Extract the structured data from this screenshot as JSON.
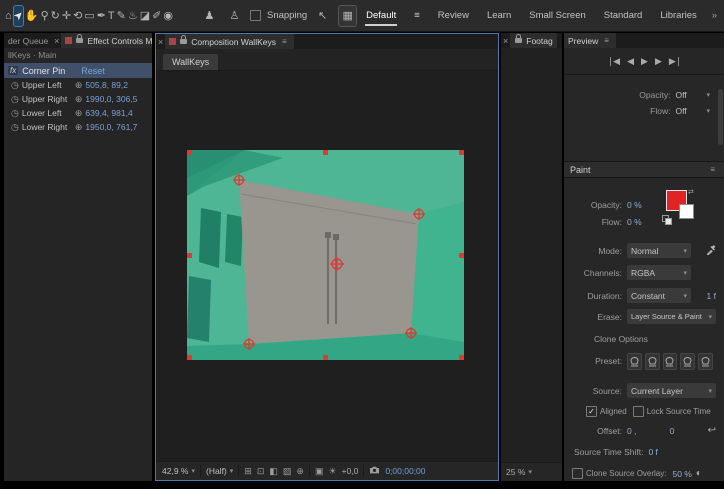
{
  "toolbar": {
    "tools": [
      {
        "name": "home",
        "glyph": "⌂"
      },
      {
        "name": "selection",
        "glyph": "➤"
      },
      {
        "name": "hand",
        "glyph": "✋"
      },
      {
        "name": "zoom",
        "glyph": "⚲"
      },
      {
        "name": "orbit",
        "glyph": "↻"
      },
      {
        "name": "pan-behind",
        "glyph": "✛"
      },
      {
        "name": "camera",
        "glyph": "⟲"
      },
      {
        "name": "mask-rect",
        "glyph": "▭"
      },
      {
        "name": "pen",
        "glyph": "✒"
      },
      {
        "name": "type",
        "glyph": "T"
      },
      {
        "name": "brush",
        "glyph": "✎"
      },
      {
        "name": "clone-stamp",
        "glyph": "♨"
      },
      {
        "name": "eraser",
        "glyph": "◪"
      },
      {
        "name": "roto-brush",
        "glyph": "✐"
      },
      {
        "name": "puppet-pin",
        "glyph": "◉"
      }
    ],
    "extra_icons": {
      "person_a": "♟",
      "person_b": "♙",
      "frame": "▦",
      "snap_after": "↖",
      "snap_grid": "▦"
    },
    "snapping_label": "Snapping",
    "workspaces": [
      "Default",
      "Review",
      "Learn",
      "Small Screen",
      "Standard",
      "Libraries"
    ],
    "overflow": "»"
  },
  "icons": {
    "menu": "≡",
    "overflow": "»",
    "close": "×",
    "chevron": "▾",
    "stopwatch": "◷",
    "crosshair": "⊕",
    "first": "❘◀",
    "prev": "◀",
    "play": "▶",
    "next": "▶",
    "last": "▶❘",
    "comp": [
      "⊞",
      "⊡",
      "◧",
      "▨",
      "⊕"
    ],
    "sun": "☀",
    "cm": "▣",
    "overlay_mode": "◐",
    "offset_reset": "↩",
    "swap": "⇄"
  },
  "effect_controls": {
    "tab_prefix": "der Queue",
    "title": "Effect Controls Main",
    "breadcrumb": "llKeys · Main",
    "effect_name": "Corner Pin",
    "fx_badge": "fx",
    "reset_label": "Reset",
    "props": [
      {
        "label": "Upper Left",
        "value": "505,8, 89,2"
      },
      {
        "label": "Upper Right",
        "value": "1990,0, 306,5"
      },
      {
        "label": "Lower Left",
        "value": "639,4, 981,4"
      },
      {
        "label": "Lower Right",
        "value": "1950,0, 761,7"
      }
    ]
  },
  "composition": {
    "title": "Composition WallKeys",
    "breadcrumb_tab": "WallKeys",
    "zoom": "42,9 %",
    "resolution": "(Half)",
    "exposure": "+0,0",
    "timecode": "0;00;00;00"
  },
  "footage": {
    "title": "Footag",
    "zoom": "25 %"
  },
  "preview": {
    "title": "Preview"
  },
  "brushes": {
    "rows": [
      {
        "label": "Opacity:",
        "value": "Off"
      },
      {
        "label": "Flow:",
        "value": "Off"
      }
    ]
  },
  "paint": {
    "title": "Paint",
    "opacity_label": "Opacity:",
    "opacity_value": "0 %",
    "flow_label": "Flow:",
    "flow_value": "0 %",
    "mode_label": "Mode:",
    "mode_value": "Normal",
    "channels_label": "Channels:",
    "channels_value": "RGBA",
    "duration_label": "Duration:",
    "duration_value": "Constant",
    "duration_suffix": "1 f",
    "erase_label": "Erase:",
    "erase_value": "Layer Source & Paint",
    "clone_options_label": "Clone Options",
    "preset_label": "Preset:",
    "source_label": "Source:",
    "source_value": "Current Layer",
    "aligned_label": "Aligned",
    "lock_label": "Lock Source Time",
    "check_glyph": "✓",
    "offset_label": "Offset:",
    "offset_x": "0 ,",
    "offset_y": "0",
    "time_shift_label": "Source Time Shift:",
    "time_shift_value": "0 f",
    "overlay_label": "Clone Source Overlay:",
    "overlay_value": "50 %"
  },
  "colors": {
    "panel_accent": "#4a7ab5",
    "value_blue": "#7aa2d8",
    "key_teal": "#3fbd97",
    "handle_red": "#e03a2f",
    "swatch_red": "#e02424",
    "swatch_white": "#ffffff"
  }
}
